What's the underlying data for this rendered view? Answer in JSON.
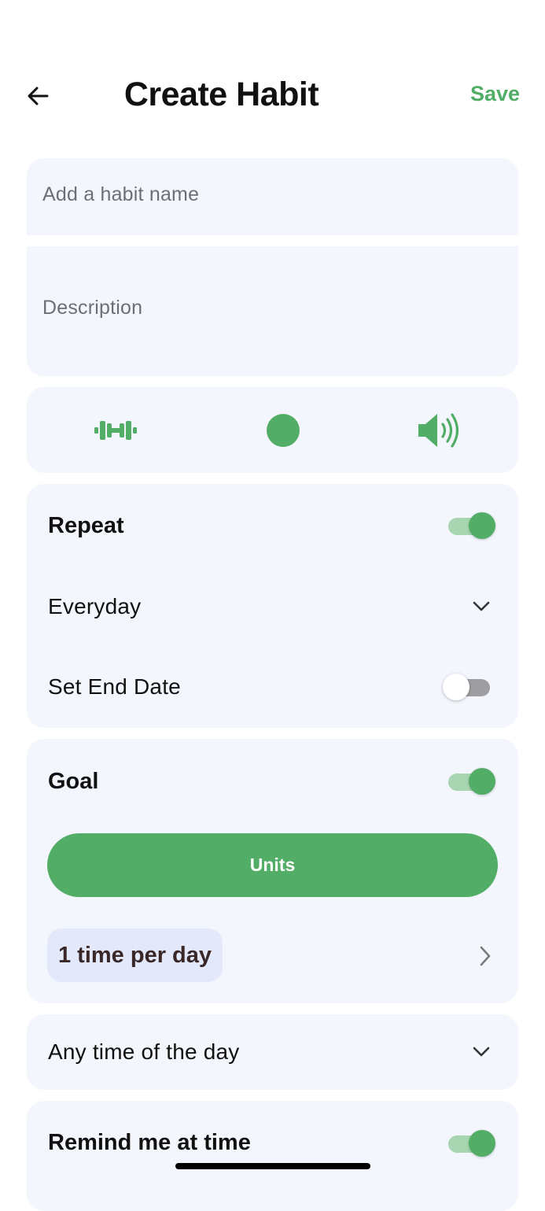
{
  "header": {
    "title": "Create Habit",
    "save_label": "Save",
    "back_icon": "arrow-left-icon"
  },
  "form": {
    "name_placeholder": "Add a habit name",
    "description_placeholder": "Description"
  },
  "icon_picker": {
    "icons": [
      "dumbbell-icon",
      "color-dot-icon",
      "speaker-icon"
    ],
    "accent_color": "#52ad66"
  },
  "repeat": {
    "label": "Repeat",
    "enabled": true,
    "frequency": "Everyday",
    "end_date_label": "Set End Date",
    "end_date_enabled": false
  },
  "goal": {
    "label": "Goal",
    "enabled": true,
    "units_label": "Units",
    "frequency_chip": "1 time per day"
  },
  "time_of_day": {
    "value": "Any time of the day"
  },
  "reminder": {
    "label": "Remind me at time",
    "enabled": true
  },
  "colors": {
    "accent": "#52ad66",
    "card_bg": "#f4f6fd",
    "chip_bg": "#e3e9fb"
  }
}
